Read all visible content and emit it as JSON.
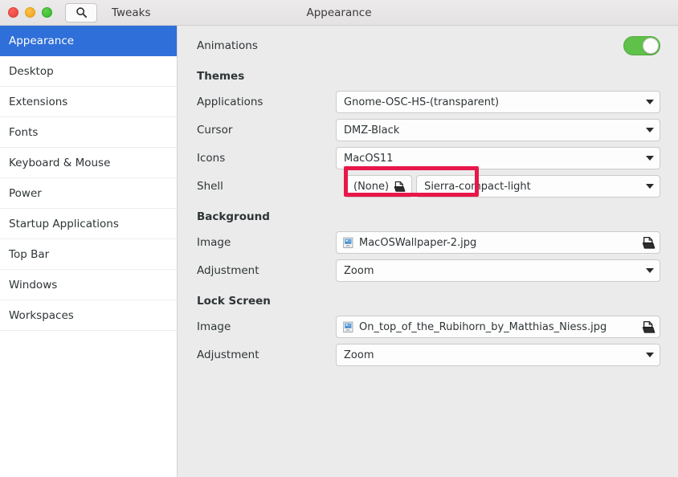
{
  "titlebar": {
    "app_name": "Tweaks",
    "window_title": "Appearance",
    "search_icon": "search-icon",
    "close_label": "close",
    "minimize_label": "minimize",
    "maximize_label": "maximize"
  },
  "sidebar": {
    "items": [
      {
        "label": "Appearance",
        "selected": true
      },
      {
        "label": "Desktop",
        "selected": false
      },
      {
        "label": "Extensions",
        "selected": false
      },
      {
        "label": "Fonts",
        "selected": false
      },
      {
        "label": "Keyboard & Mouse",
        "selected": false
      },
      {
        "label": "Power",
        "selected": false
      },
      {
        "label": "Startup Applications",
        "selected": false
      },
      {
        "label": "Top Bar",
        "selected": false
      },
      {
        "label": "Windows",
        "selected": false
      },
      {
        "label": "Workspaces",
        "selected": false
      }
    ]
  },
  "content": {
    "animations": {
      "label": "Animations",
      "toggle_state": "on",
      "toggle_color": "#5fc04a"
    },
    "themes": {
      "heading": "Themes",
      "applications": {
        "label": "Applications",
        "value": "Gnome-OSC-HS-(transparent)"
      },
      "cursor": {
        "label": "Cursor",
        "value": "DMZ-Black"
      },
      "icons": {
        "label": "Icons",
        "value": "MacOS11"
      },
      "shell": {
        "label": "Shell",
        "none_button": "(None)",
        "none_icon": "document-open-icon",
        "value": "Sierra-compact-light"
      }
    },
    "background": {
      "heading": "Background",
      "image": {
        "label": "Image",
        "value": "MacOSWallpaper-2.jpg",
        "thumb_icon": "image-file-icon",
        "open_icon": "document-open-icon"
      },
      "adjustment": {
        "label": "Adjustment",
        "value": "Zoom"
      }
    },
    "lock_screen": {
      "heading": "Lock Screen",
      "image": {
        "label": "Image",
        "value": "On_top_of_the_Rubihorn_by_Matthias_Niess.jpg",
        "thumb_icon": "image-file-icon",
        "open_icon": "document-open-icon"
      },
      "adjustment": {
        "label": "Adjustment",
        "value": "Zoom"
      }
    }
  },
  "annotation": {
    "color": "#e8174a",
    "target": "Sierra-compact-light"
  }
}
